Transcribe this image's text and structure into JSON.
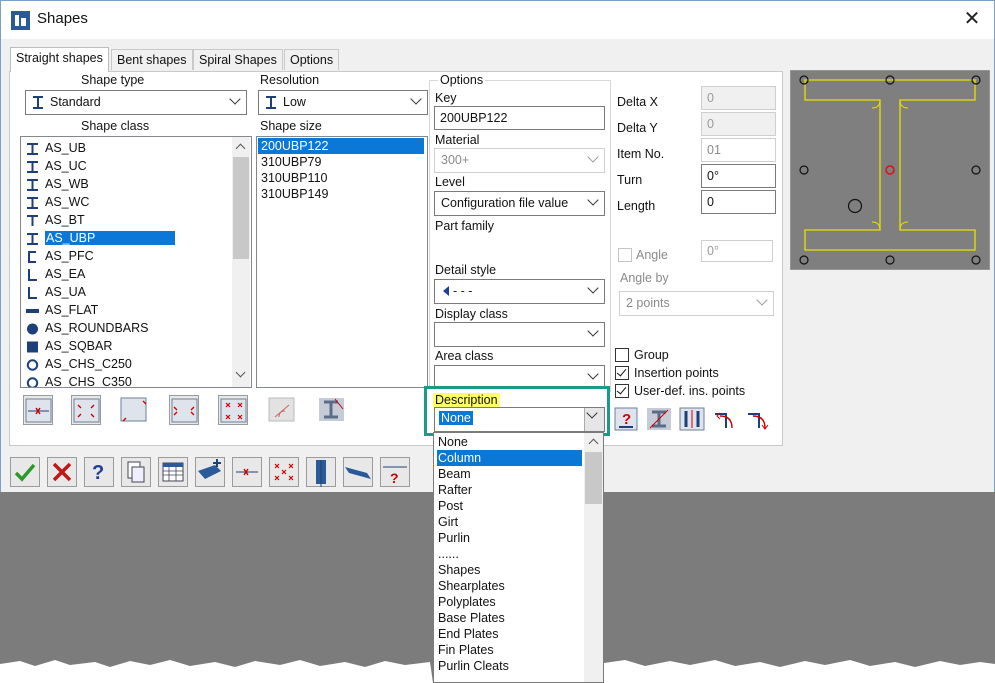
{
  "window": {
    "title": "Shapes",
    "close_label": "✕"
  },
  "tabs": [
    {
      "label": "Straight shapes",
      "active": true
    },
    {
      "label": "Bent shapes"
    },
    {
      "label": "Spiral Shapes"
    },
    {
      "label": "Options"
    }
  ],
  "shape_type": {
    "label": "Shape type",
    "value": "Standard"
  },
  "resolution": {
    "label": "Resolution",
    "value": "Low"
  },
  "shape_class": {
    "label": "Shape class",
    "items": [
      "AS_UB",
      "AS_UC",
      "AS_WB",
      "AS_WC",
      "AS_BT",
      "AS_UBP",
      "AS_PFC",
      "AS_EA",
      "AS_UA",
      "AS_FLAT",
      "AS_ROUNDBARS",
      "AS_SQBAR",
      "AS_CHS_C250",
      "AS_CHS_C350"
    ],
    "icons": [
      "i-beam-icon",
      "i-beam-icon",
      "i-beam-icon",
      "i-beam-icon",
      "t-beam-icon",
      "i-beam-icon",
      "channel-icon",
      "angle-icon",
      "angle-icon",
      "flat-bar-icon",
      "round-bar-icon",
      "square-bar-icon",
      "circle-hollow-icon",
      "circle-hollow-icon"
    ],
    "selected": "AS_UBP"
  },
  "shape_size": {
    "label": "Shape size",
    "items": [
      "200UBP122",
      "310UBP79",
      "310UBP110",
      "310UBP149"
    ],
    "selected": "200UBP122"
  },
  "options": {
    "group_label": "Options",
    "key_label": "Key",
    "key_value": "200UBP122",
    "material_label": "Material",
    "material_value": "300+",
    "level_label": "Level",
    "level_value": "Configuration file value",
    "part_family_label": "Part family",
    "detail_style_label": "Detail style",
    "detail_style_value": "- - -",
    "display_class_label": "Display class",
    "display_class_value": "",
    "area_class_label": "Area class",
    "area_class_value": "",
    "description_label": "Description",
    "description_value": "None"
  },
  "placement": {
    "delta_x_label": "Delta X",
    "delta_x_value": "0",
    "delta_y_label": "Delta Y",
    "delta_y_value": "0",
    "item_no_label": "Item No.",
    "item_no_value": "01",
    "turn_label": "Turn",
    "turn_value": "0°",
    "length_label": "Length",
    "length_value": "0",
    "angle_label": "Angle",
    "angle_value": "0°",
    "angle_by_label": "Angle by",
    "angle_by_value": "2 points",
    "group_label": "Group",
    "insertion_points_label": "Insertion points",
    "user_def_label": "User-def. ins. points"
  },
  "description_dropdown": {
    "items": [
      "None",
      "Column",
      "Beam",
      "Rafter",
      "Post",
      "Girt",
      "Purlin",
      "......",
      "Shapes",
      "Shearplates",
      "Polyplates",
      "Base Plates",
      "End Plates",
      "Fin Plates",
      "Purlin Cleats"
    ],
    "highlighted": "Column"
  },
  "colors": {
    "accent": "#0b78d7",
    "highlight_box": "#1a9b8a",
    "label_highlight": "#ffff66",
    "preview_bg": "#7f7f7f",
    "preview_line": "#e8e000"
  }
}
